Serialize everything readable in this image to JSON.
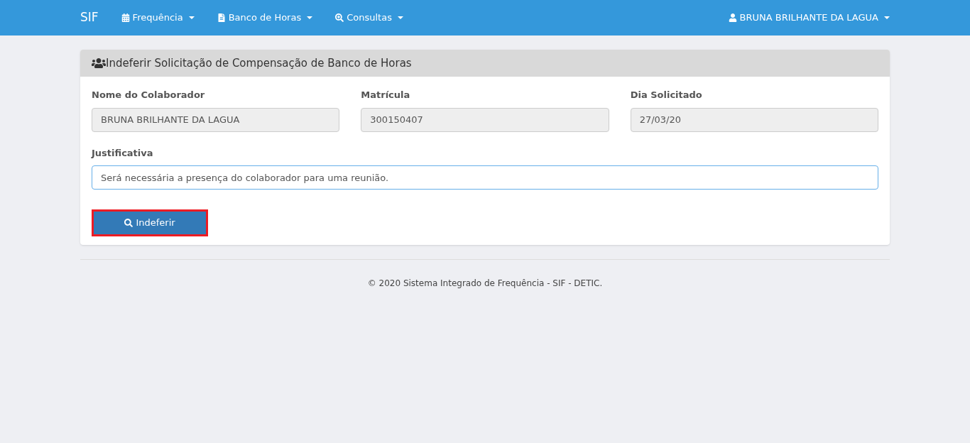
{
  "navbar": {
    "brand": "SIF",
    "menus": [
      {
        "label": "Frequência",
        "kind": "calendar"
      },
      {
        "label": "Banco de Horas",
        "kind": "document"
      },
      {
        "label": "Consultas",
        "kind": "lookup"
      }
    ],
    "user": "BRUNA BRILHANTE DA LAGUA"
  },
  "panel": {
    "title": "Indeferir Solicitação de Compensação de Banco de Horas",
    "fields": [
      {
        "label": "Nome do Colaborador",
        "value": "BRUNA BRILHANTE DA LAGUA",
        "readonly": true
      },
      {
        "label": "Matrícula",
        "value": "300150407",
        "readonly": true
      },
      {
        "label": "Dia Solicitado",
        "value": "27/03/20",
        "readonly": true
      }
    ],
    "justification": {
      "label": "Justificativa",
      "value": "Será necessária a presença do colaborador para uma reunião.",
      "focused": true
    },
    "button": {
      "label": "Indeferir",
      "highlighted": true
    }
  },
  "footer": "© 2020 Sistema Integrado de Frequência - SIF - DETIC."
}
